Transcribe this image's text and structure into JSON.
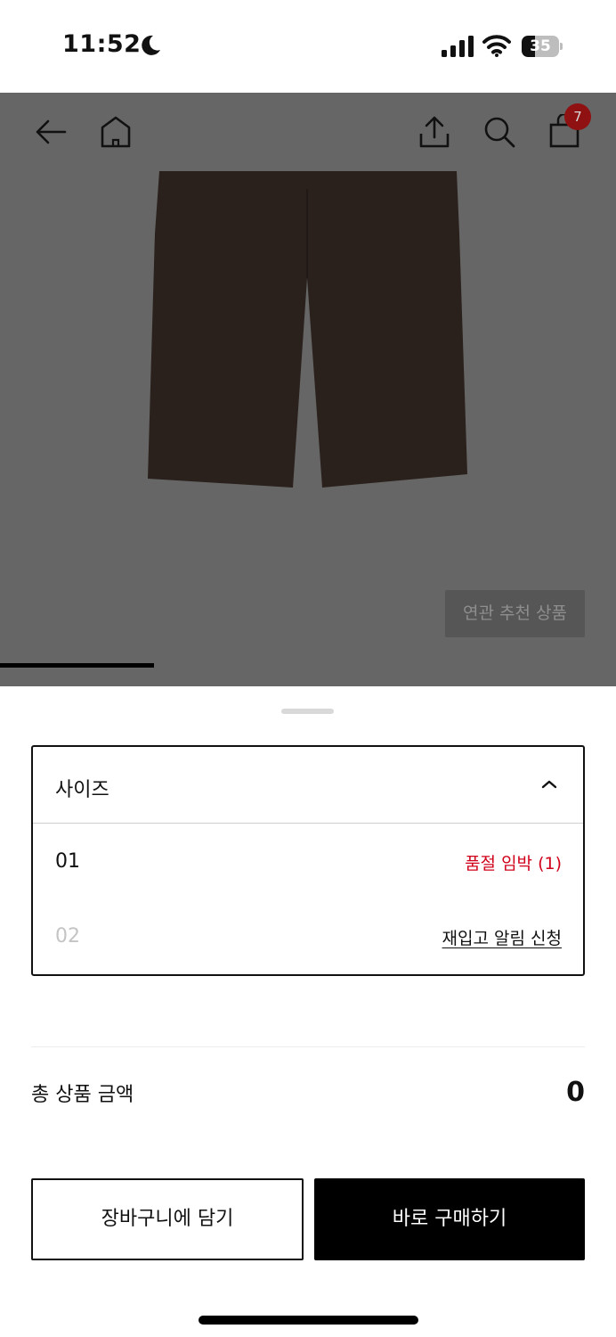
{
  "status_bar": {
    "time": "11:52",
    "battery_level": "35",
    "battery_fraction": 0.35
  },
  "nav": {
    "cart_count": "7",
    "icons": [
      "back-arrow-icon",
      "home-icon",
      "share-icon",
      "search-icon",
      "cart-icon"
    ]
  },
  "product": {
    "related_button_label": "연관 추천 상품",
    "image_indicator_fraction": 0.25,
    "product_color": "#2a211c"
  },
  "size_select": {
    "title": "사이즈",
    "options": [
      {
        "label": "01",
        "status": "품절 임박 (1)",
        "available": true
      },
      {
        "label": "02",
        "status": "재입고 알림 신청",
        "available": false
      }
    ]
  },
  "summary": {
    "total_label": "총 상품 금액",
    "total_value": "0"
  },
  "actions": {
    "cart_label": "장바구니에 담기",
    "buy_label": "바로 구매하기"
  },
  "colors": {
    "overlay": "#666666",
    "badge": "#8f1111",
    "alert_red": "#d0021b",
    "primary": "#000000"
  }
}
